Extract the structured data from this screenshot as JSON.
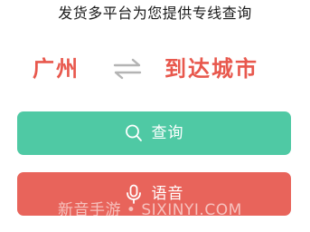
{
  "subtitle": "发货多平台为您提供专线查询",
  "route": {
    "from_city": "广州",
    "to_city": "到达城市",
    "swap_icon": "swap-arrows-icon"
  },
  "buttons": {
    "query_label": "查询",
    "query_icon": "search-icon",
    "voice_label": "语音",
    "voice_icon": "microphone-icon"
  },
  "watermark": "新音手游 • SIXINYI.COM",
  "colors": {
    "accent_red": "#e8584d",
    "query_green": "#4fc9a4",
    "voice_red": "#e8645b",
    "swap_gray": "#b4b4b4"
  }
}
